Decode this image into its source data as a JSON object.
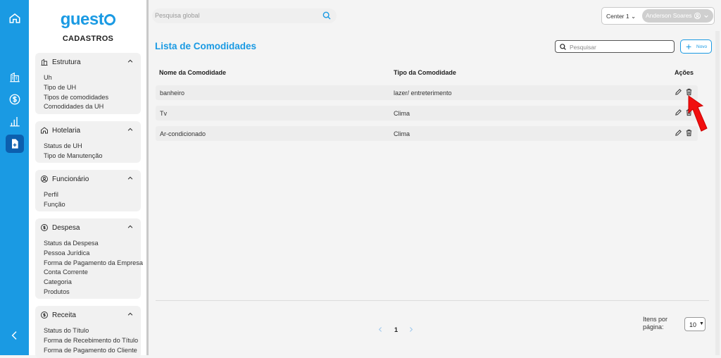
{
  "brand": {
    "name_prefix": "guest",
    "accent": "#1a9ae3",
    "rail_active": "#0c5fae"
  },
  "rail": {
    "items": [
      "home-icon",
      "building-icon",
      "dollar-icon",
      "bar-chart-icon",
      "add-document-icon"
    ],
    "active": "add-document-icon",
    "collapse": "chevron-left-icon"
  },
  "sidebar": {
    "title": "CADASTROS",
    "sections": [
      {
        "label": "Estrutura",
        "icon": "building-icon",
        "items": [
          "Uh",
          "Tipo de UH",
          "Tipos de comodidades",
          "Comodidades da UH"
        ]
      },
      {
        "label": "Hotelaria",
        "icon": "home-icon",
        "items": [
          "Status de UH",
          "Tipo de Manutenção"
        ]
      },
      {
        "label": "Funcionário",
        "icon": "user-circle-icon",
        "items": [
          "Perfil",
          "Função"
        ]
      },
      {
        "label": "Despesa",
        "icon": "dollar-circle-icon",
        "items": [
          "Status da Despesa",
          "Pessoa Jurídica",
          "Forma de Pagamento da Empresa",
          "Conta Corrente",
          "Categoria",
          "Produtos"
        ]
      },
      {
        "label": "Receita",
        "icon": "dollar-circle-icon",
        "items": [
          "Status do Título",
          "Forma de Recebimento do Título",
          "Forma de Pagamento do Cliente"
        ]
      }
    ]
  },
  "topbar": {
    "search_placeholder": "Pesquisa global",
    "center": "Center 1",
    "user": "Anderson Soares"
  },
  "main": {
    "title": "Lista de Comodidades",
    "search_placeholder": "Pesquisar",
    "new_button": "Novo",
    "columns": [
      "Nome da Comodidade",
      "Tipo da Comodidade",
      "Ações"
    ],
    "rows": [
      {
        "name": "banheiro",
        "type": "lazer/ entreterimento"
      },
      {
        "name": "Tv",
        "type": "Clima"
      },
      {
        "name": "Ar-condicionado",
        "type": "Clima"
      }
    ],
    "pagination": {
      "current": "1"
    },
    "per_page_label_1": "Itens por",
    "per_page_label_2": "página:",
    "per_page_value": "10"
  }
}
